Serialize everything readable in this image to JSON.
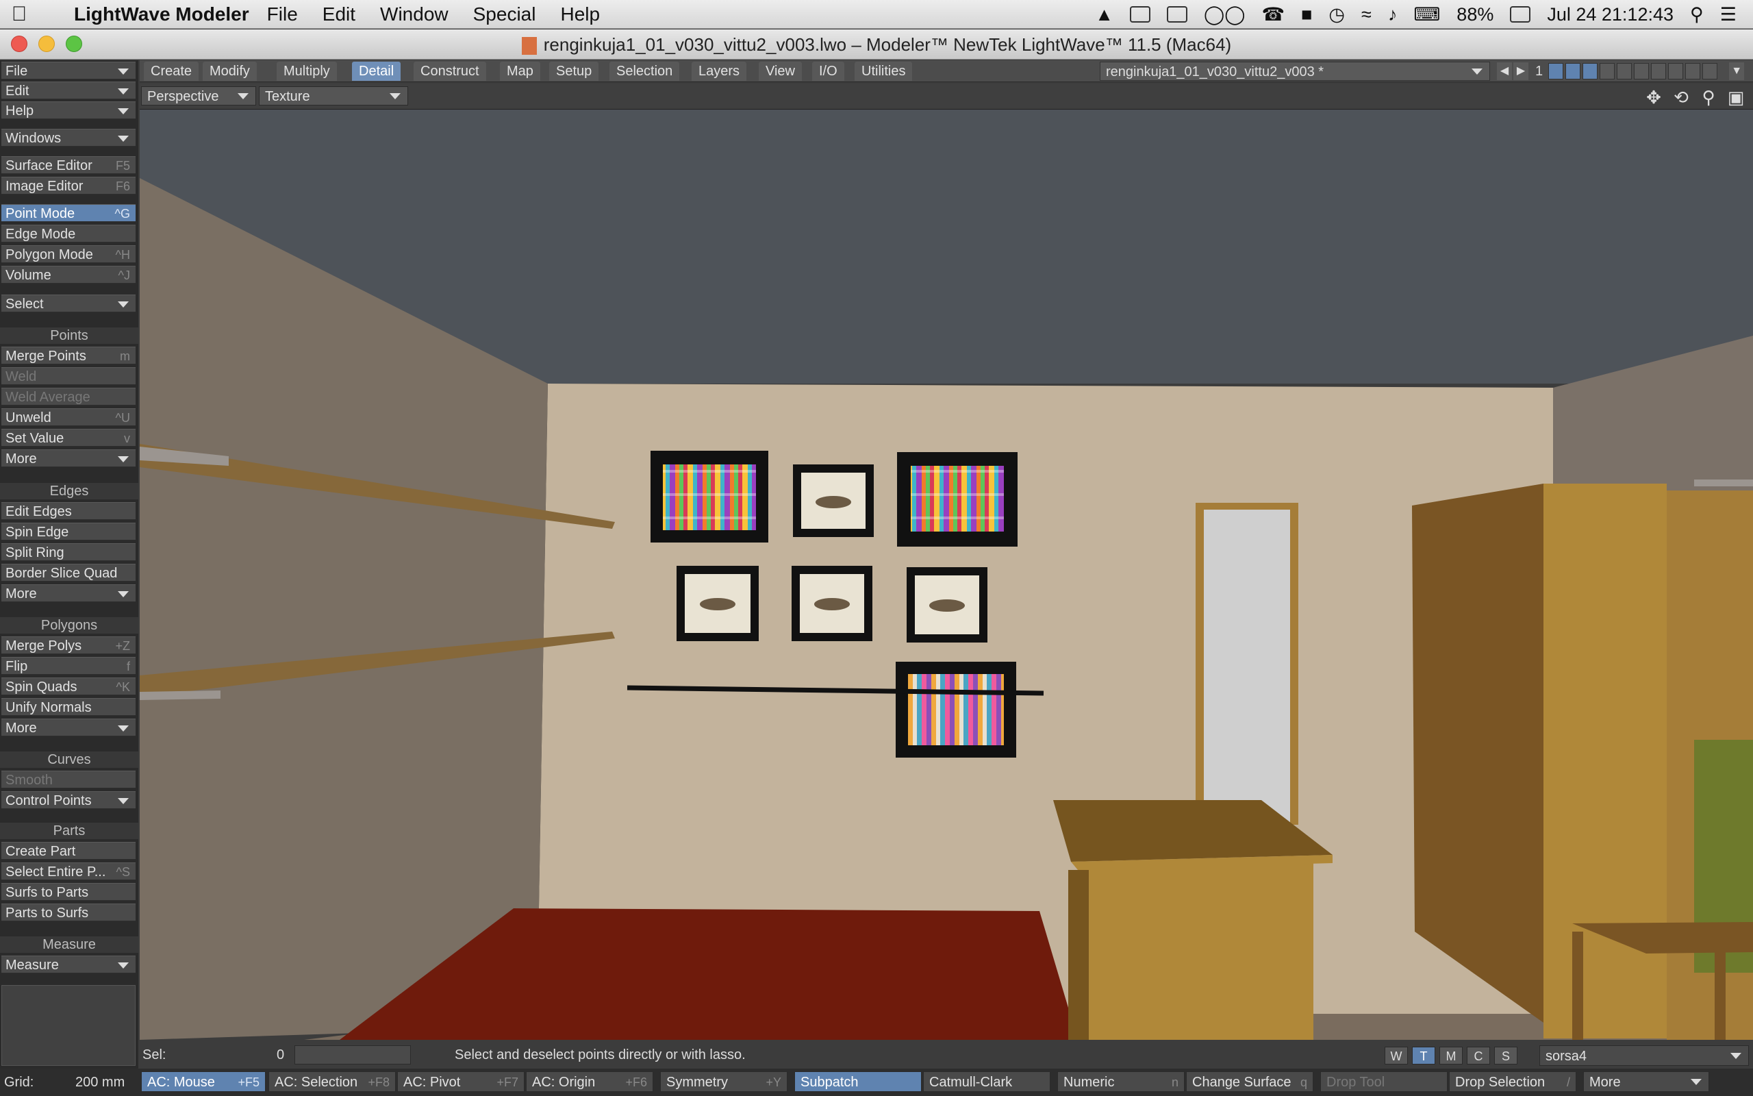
{
  "menubar": {
    "app": "LightWave Modeler",
    "items": [
      "File",
      "Edit",
      "Window",
      "Special",
      "Help"
    ],
    "battery": "88%",
    "datetime": "Jul 24  21:12:43"
  },
  "window": {
    "title": "renginkuja1_01_v030_vittu2_v003.lwo – Modeler™ NewTek LightWave™ 11.5 (Mac64)"
  },
  "sidebar": {
    "file": "File",
    "edit": "Edit",
    "help": "Help",
    "windows": "Windows",
    "surface_editor": "Surface Editor",
    "surface_editor_key": "F5",
    "image_editor": "Image Editor",
    "image_editor_key": "F6",
    "point_mode": "Point Mode",
    "point_mode_key": "^G",
    "edge_mode": "Edge Mode",
    "polygon_mode": "Polygon Mode",
    "polygon_mode_key": "^H",
    "volume": "Volume",
    "volume_key": "^J",
    "select": "Select",
    "points_header": "Points",
    "merge_points": "Merge Points",
    "merge_points_key": "m",
    "weld": "Weld",
    "weld_average": "Weld Average",
    "unweld": "Unweld",
    "unweld_key": "^U",
    "set_value": "Set Value",
    "set_value_key": "v",
    "more": "More",
    "edges_header": "Edges",
    "edit_edges": "Edit Edges",
    "spin_edge": "Spin Edge",
    "split_ring": "Split Ring",
    "border_slice_quad": "Border Slice Quad",
    "polygons_header": "Polygons",
    "merge_polys": "Merge Polys",
    "merge_polys_key": "+Z",
    "flip": "Flip",
    "flip_key": "f",
    "spin_quads": "Spin Quads",
    "spin_quads_key": "^K",
    "unify_normals": "Unify Normals",
    "curves_header": "Curves",
    "smooth": "Smooth",
    "control_points": "Control Points",
    "parts_header": "Parts",
    "create_part": "Create Part",
    "select_entire_part": "Select Entire P...",
    "select_entire_part_key": "^S",
    "surfs_to_parts": "Surfs to Parts",
    "parts_to_surfs": "Parts to Surfs",
    "measure_header": "Measure",
    "measure": "Measure"
  },
  "tabs": [
    "Create",
    "Modify",
    "Multiply",
    "Detail",
    "Construct",
    "Map",
    "Setup",
    "Selection",
    "Layers",
    "View",
    "I/O",
    "Utilities"
  ],
  "active_tab": "Detail",
  "document_select": "renginkuja1_01_v030_vittu2_v003 *",
  "layer_number": "1",
  "viewport": {
    "view_type": "Perspective",
    "render_mode": "Texture"
  },
  "colors": {
    "ceiling": "#4e5359",
    "back_wall": "#c3b39c",
    "left_wall": "#7a6f63",
    "right_wall": "#7b7168",
    "floor": "#7a6c5e",
    "rug": "#6f1b0c",
    "wood_light": "#b08839",
    "wood_dark": "#7a5524",
    "accent": "#5f83b0"
  },
  "status": {
    "sel_label": "Sel:",
    "sel_count": "0",
    "hint": "Select and deselect points directly or with lasso.",
    "view_buttons": [
      "W",
      "T",
      "M",
      "C",
      "S"
    ],
    "active_view_button": "T",
    "surface": "sorsa4"
  },
  "bottombar": {
    "grid_label": "Grid:",
    "grid_value": "200 mm",
    "ac_mouse": "AC: Mouse",
    "ac_mouse_key": "+F5",
    "ac_selection": "AC: Selection",
    "ac_selection_key": "+F8",
    "ac_pivot": "AC: Pivot",
    "ac_pivot_key": "+F7",
    "ac_origin": "AC: Origin",
    "ac_origin_key": "+F6",
    "symmetry": "Symmetry",
    "symmetry_key": "+Y",
    "subpatch": "Subpatch",
    "catmull_clark": "Catmull-Clark",
    "numeric": "Numeric",
    "numeric_key": "n",
    "change_surface": "Change Surface",
    "change_surface_key": "q",
    "drop_tool": "Drop Tool",
    "drop_selection": "Drop Selection",
    "drop_selection_key": "/",
    "more": "More"
  }
}
